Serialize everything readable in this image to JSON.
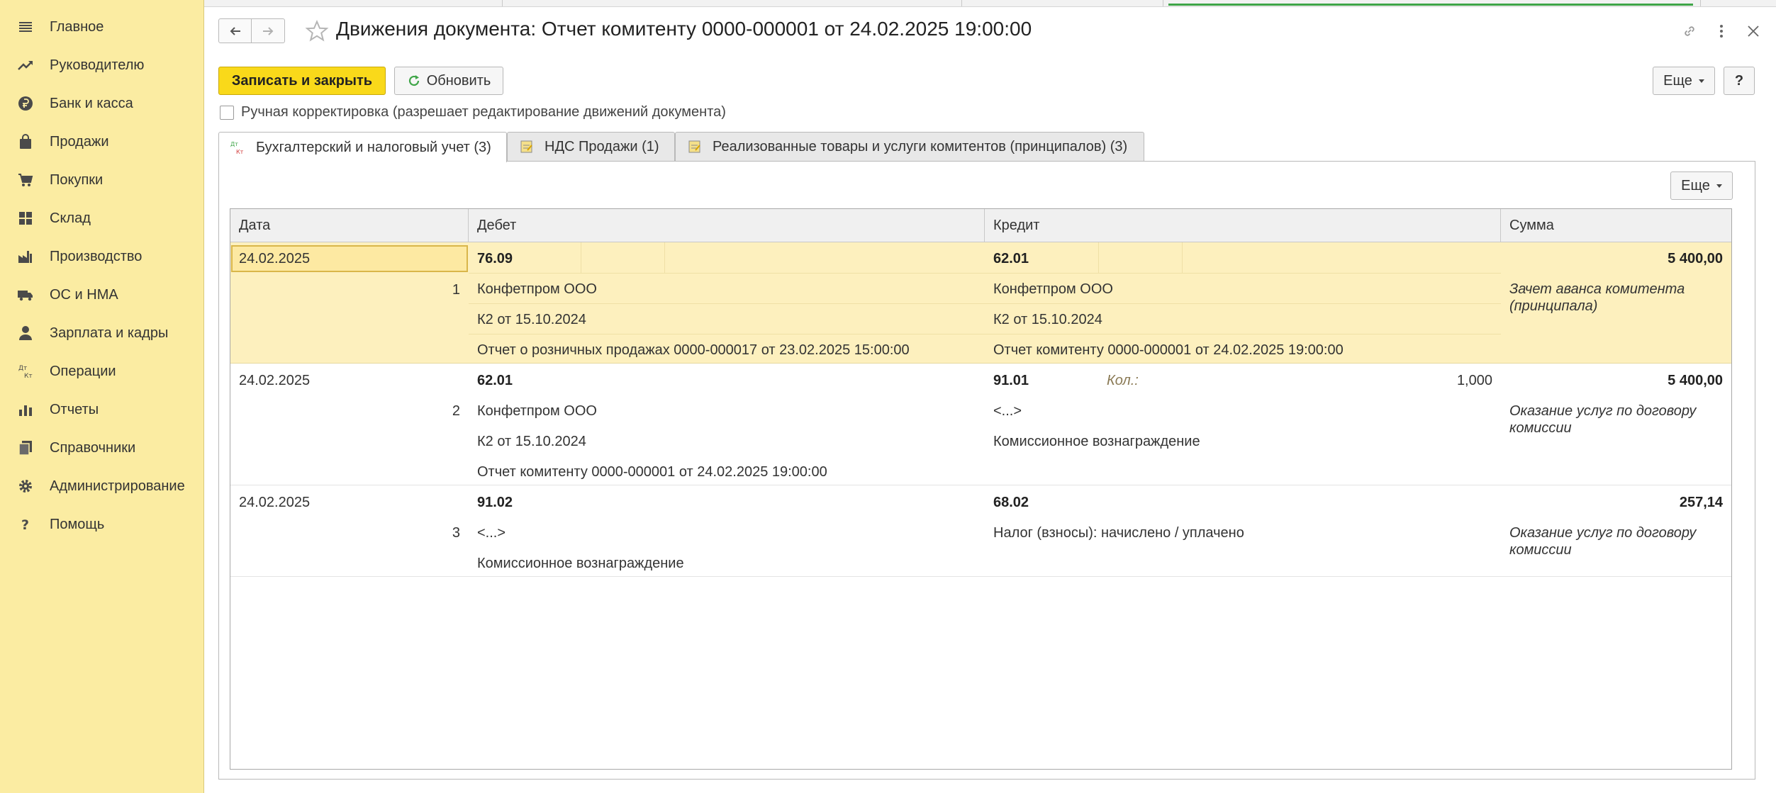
{
  "sidebar": {
    "items": [
      {
        "label": "Главное",
        "icon": "menu-lines-icon"
      },
      {
        "label": "Руководителю",
        "icon": "trend-icon"
      },
      {
        "label": "Банк и касса",
        "icon": "ruble-coin-icon"
      },
      {
        "label": "Продажи",
        "icon": "shopping-bag-icon"
      },
      {
        "label": "Покупки",
        "icon": "cart-icon"
      },
      {
        "label": "Склад",
        "icon": "warehouse-grid-icon"
      },
      {
        "label": "Производство",
        "icon": "factory-icon"
      },
      {
        "label": "ОС и НМА",
        "icon": "truck-icon"
      },
      {
        "label": "Зарплата и кадры",
        "icon": "person-icon"
      },
      {
        "label": "Операции",
        "icon": "debit-credit-icon"
      },
      {
        "label": "Отчеты",
        "icon": "bar-chart-icon"
      },
      {
        "label": "Справочники",
        "icon": "books-icon"
      },
      {
        "label": "Администрирование",
        "icon": "gear-icon"
      },
      {
        "label": "Помощь",
        "icon": "question-icon"
      }
    ]
  },
  "header": {
    "title": "Движения документа: Отчет комитенту 0000-000001 от 24.02.2025 19:00:00"
  },
  "toolbar": {
    "save_close": "Записать и закрыть",
    "refresh": "Обновить",
    "more": "Еще",
    "help": "?"
  },
  "manual_correction": {
    "label": "Ручная корректировка (разрешает редактирование движений документа)",
    "checked": false
  },
  "tabs": [
    {
      "label": "Бухгалтерский и налоговый учет (3)",
      "active": true,
      "icon": "debit-credit-icon"
    },
    {
      "label": "НДС Продажи (1)",
      "active": false,
      "icon": "register-icon"
    },
    {
      "label": "Реализованные товары и услуги комитентов (принципалов) (3)",
      "active": false,
      "icon": "register-icon"
    }
  ],
  "panel": {
    "more": "Еще"
  },
  "grid": {
    "columns": [
      "Дата",
      "Дебет",
      "Кредит",
      "Сумма"
    ],
    "rows": [
      {
        "date": "24.02.2025",
        "num": "1",
        "debit_account": "76.09",
        "debit_lines": [
          "Конфетпром ООО",
          "К2 от 15.10.2024",
          "Отчет о розничных продажах 0000-000017 от 23.02.2025 15:00:00"
        ],
        "credit_account": "62.01",
        "credit_qty_label": "",
        "credit_qty": "",
        "credit_lines": [
          "Конфетпром ООО",
          "К2 от 15.10.2024",
          "Отчет комитенту 0000-000001 от 24.02.2025 19:00:00"
        ],
        "amount": "5 400,00",
        "content": "Зачет аванса комитента (принципала)"
      },
      {
        "date": "24.02.2025",
        "num": "2",
        "debit_account": "62.01",
        "debit_lines": [
          "Конфетпром ООО",
          "К2 от 15.10.2024",
          "Отчет комитенту 0000-000001 от 24.02.2025 19:00:00"
        ],
        "credit_account": "91.01",
        "credit_qty_label": "Кол.:",
        "credit_qty": "1,000",
        "credit_lines": [
          "<...>",
          "Комиссионное вознаграждение"
        ],
        "amount": "5 400,00",
        "content": "Оказание услуг по договору комиссии"
      },
      {
        "date": "24.02.2025",
        "num": "3",
        "debit_account": "91.02",
        "debit_lines": [
          "<...>",
          "Комиссионное вознаграждение"
        ],
        "credit_account": "68.02",
        "credit_qty_label": "",
        "credit_qty": "",
        "credit_lines": [
          "Налог (взносы): начислено / уплачено"
        ],
        "amount": "257,14",
        "content": "Оказание услуг по договору комиссии"
      }
    ]
  },
  "colors": {
    "sidebar_bg": "#fbeca2",
    "primary_button": "#f9d91a",
    "selected_row": "#fdf0be",
    "active_strip": "#3fa548"
  }
}
